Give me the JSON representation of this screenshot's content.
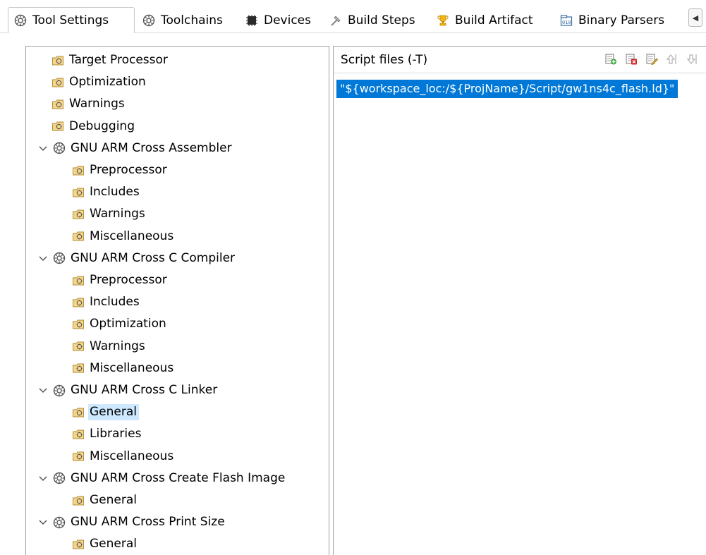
{
  "tabs": [
    {
      "label": "Tool Settings",
      "icon": "gear-icon",
      "active": true
    },
    {
      "label": "Toolchains",
      "icon": "gear-icon",
      "active": false
    },
    {
      "label": "Devices",
      "icon": "chip-icon",
      "active": false
    },
    {
      "label": "Build Steps",
      "icon": "hammer-icon",
      "active": false
    },
    {
      "label": "Build Artifact",
      "icon": "trophy-icon",
      "active": false
    },
    {
      "label": "Binary Parsers",
      "icon": "binary-icon",
      "active": false
    }
  ],
  "tab_scroll_glyph": "◀",
  "tree": {
    "items": [
      {
        "label": "Target Processor",
        "kind": "page"
      },
      {
        "label": "Optimization",
        "kind": "page"
      },
      {
        "label": "Warnings",
        "kind": "page"
      },
      {
        "label": "Debugging",
        "kind": "page"
      },
      {
        "label": "GNU ARM Cross Assembler",
        "kind": "tool"
      },
      {
        "label": "Preprocessor",
        "kind": "page"
      },
      {
        "label": "Includes",
        "kind": "page"
      },
      {
        "label": "Warnings",
        "kind": "page"
      },
      {
        "label": "Miscellaneous",
        "kind": "page"
      },
      {
        "label": "GNU ARM Cross C Compiler",
        "kind": "tool"
      },
      {
        "label": "Preprocessor",
        "kind": "page"
      },
      {
        "label": "Includes",
        "kind": "page"
      },
      {
        "label": "Optimization",
        "kind": "page"
      },
      {
        "label": "Warnings",
        "kind": "page"
      },
      {
        "label": "Miscellaneous",
        "kind": "page"
      },
      {
        "label": "GNU ARM Cross C Linker",
        "kind": "tool"
      },
      {
        "label": "General",
        "kind": "page",
        "selected": true
      },
      {
        "label": "Libraries",
        "kind": "page"
      },
      {
        "label": "Miscellaneous",
        "kind": "page"
      },
      {
        "label": "GNU ARM Cross Create Flash Image",
        "kind": "tool"
      },
      {
        "label": "General",
        "kind": "page"
      },
      {
        "label": "GNU ARM Cross Print Size",
        "kind": "tool"
      },
      {
        "label": "General",
        "kind": "page"
      }
    ]
  },
  "script_files": {
    "title": "Script files (-T)",
    "tools": [
      {
        "name": "add-icon"
      },
      {
        "name": "delete-icon"
      },
      {
        "name": "edit-icon"
      },
      {
        "name": "move-up-icon"
      },
      {
        "name": "move-down-icon"
      }
    ],
    "entries": [
      "\"${workspace_loc:/${ProjName}/Script/gw1ns4c_flash.ld}\""
    ]
  },
  "colors": {
    "selection": "#0078d7",
    "tree_selection": "#cde8ff",
    "border": "#a0a0a0"
  }
}
